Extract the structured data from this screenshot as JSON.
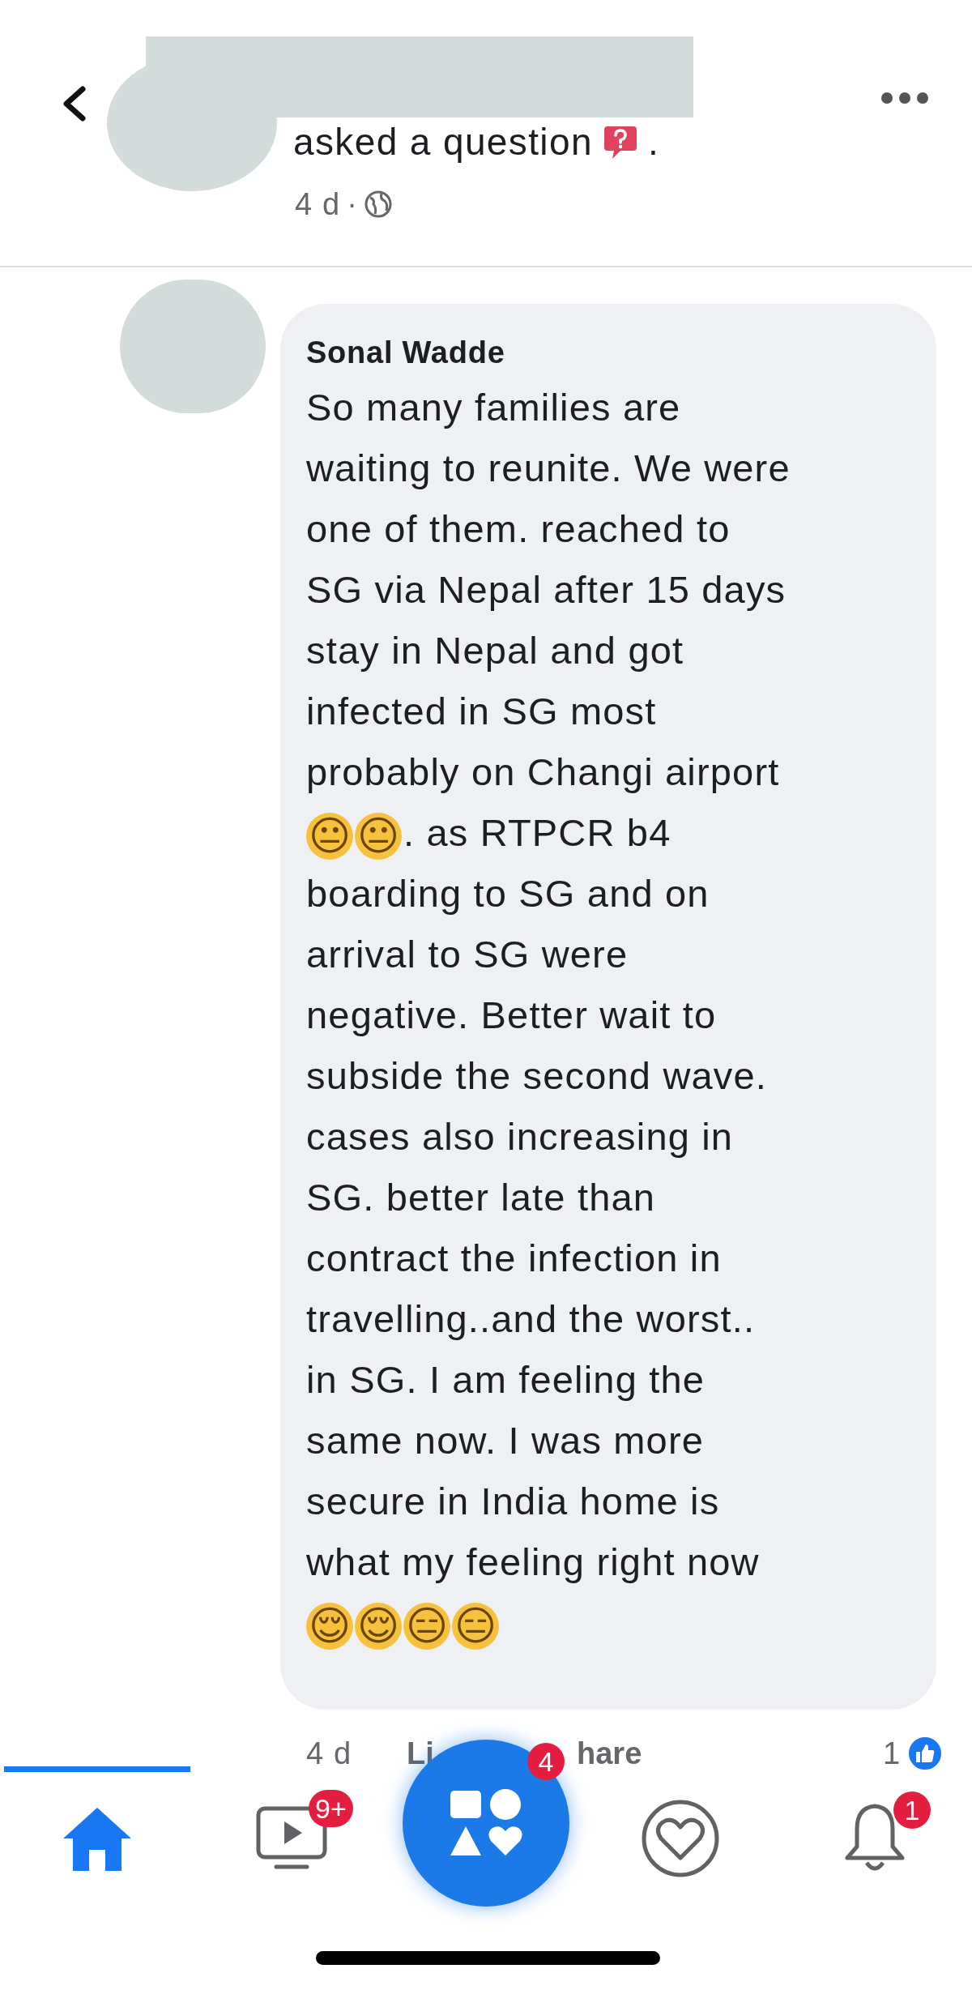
{
  "post_header": {
    "action": "asked a question",
    "action_end": ".",
    "time": "4 d",
    "separator": "·"
  },
  "comment": {
    "author": "Sonal Wadde",
    "body": [
      {
        "kind": "text",
        "text": "So many families are\nwaiting to reunite. We were\none of them. reached to\nSG via Nepal after 15 days\nstay in Nepal and got\ninfected in SG most\nprobably on Changi airport\n"
      },
      {
        "kind": "emoji",
        "text": "😐"
      },
      {
        "kind": "emoji",
        "text": "😐"
      },
      {
        "kind": "text",
        "text": ". as RTPCR b4\nboarding to SG and on\narrival to SG were\nnegative. Better wait to\nsubside the second wave.\ncases also increasing in\nSG. better late than\ncontract the infection in\ntravelling..and the worst..\nin SG. I am feeling the\nsame now. I was more\nsecure in India home is\nwhat my feeling right now\n"
      },
      {
        "kind": "emoji",
        "text": "😌"
      },
      {
        "kind": "emoji",
        "text": "😌"
      },
      {
        "kind": "emoji",
        "text": "😑"
      },
      {
        "kind": "emoji",
        "text": "😑"
      }
    ],
    "time": "4 d",
    "actions": [
      "Li",
      "hare"
    ],
    "like_count": "1"
  },
  "nav": [
    {
      "kind": "home",
      "selected": true
    },
    {
      "kind": "video",
      "selected": false,
      "badge": "9+"
    },
    {
      "kind": "menu",
      "selected": false,
      "badge": "4"
    },
    {
      "kind": "dating",
      "selected": false
    },
    {
      "kind": "bell",
      "selected": false,
      "badge": "1"
    }
  ]
}
